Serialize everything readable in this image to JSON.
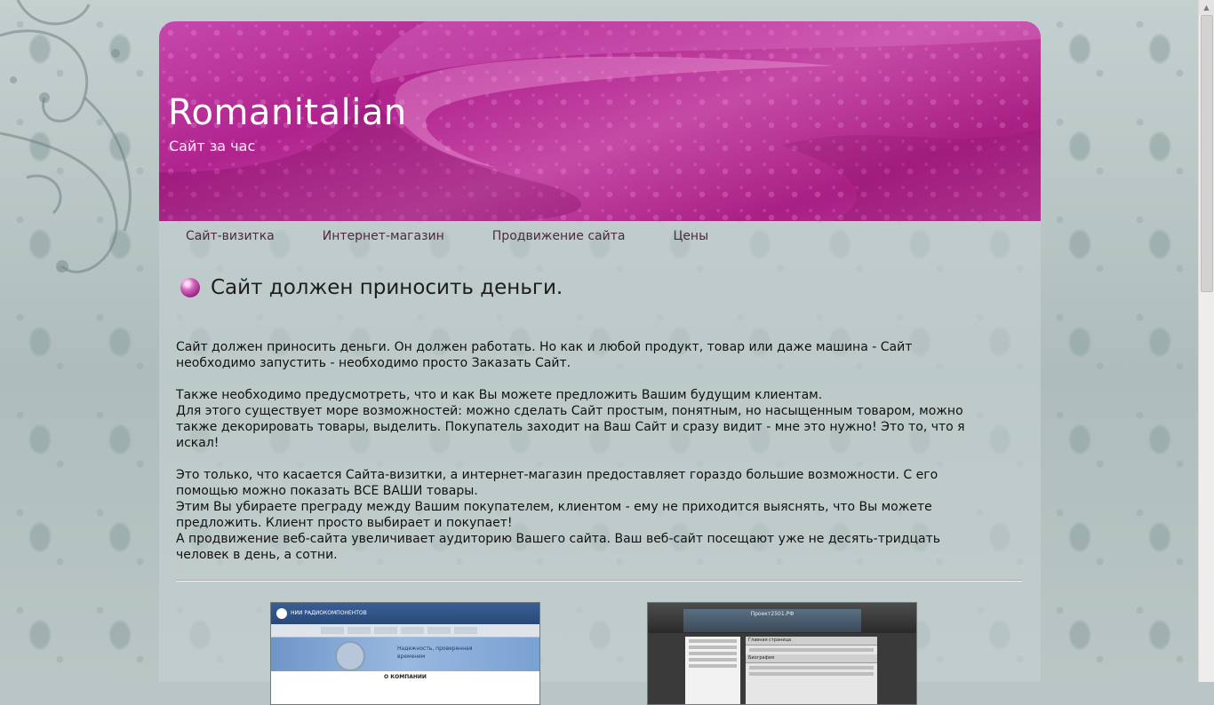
{
  "site": {
    "title": "Romanitalian",
    "tagline": "Сайт за час"
  },
  "nav": {
    "items": [
      {
        "label": "Сайт-визитка"
      },
      {
        "label": "Интернет-магазин"
      },
      {
        "label": "Продвижение сайта"
      },
      {
        "label": "Цены"
      }
    ]
  },
  "article": {
    "heading": "Сайт должен приносить деньги.",
    "p1_l1": "Сайт должен приносить деньги. Он должен работать. Но как и любой продукт, товар или даже машина - Сайт",
    "p1_l2": "необходимо запустить - необходимо просто Заказать Сайт.",
    "p2_l1": "Также необходимо предусмотреть, что и как Вы можете предложить Вашим будущим клиентам.",
    "p2_l2": "Для этого существует море возможностей: можно сделать Сайт простым, понятным, но насыщенным товаром, можно",
    "p2_l3": "также декорировать товары, выделить. Покупатель заходит на Ваш Сайт и сразу видит - мне это нужно! Это то, что я",
    "p2_l4": "искал!",
    "p3_l1": "Это только, что касается Сайта-визитки, а интернет-магазин предоставляет гораздо большие возможности. С его",
    "p3_l2": "помощью можно показать ВСЕ ВАШИ товары.",
    "p3_l3": "Этим Вы убираете преграду между Вашим покупателем, клиентом - ему не приходится выяснять, что Вы можете",
    "p3_l4": "предложить. Клиент просто выбирает и покупает!",
    "p3_l5": "А продвижение веб-сайта увеличивает аудиторию Вашего сайта. Ваш веб-сайт посещают уже не десять-тридцать",
    "p3_l6": "человек в день, а сотни."
  },
  "portfolio": {
    "thumb1": {
      "header": "НИИ РАДИОКОМПОНЕНТОВ",
      "slogan_1": "Надежность, проверенная",
      "slogan_2": "временем",
      "section": "О КОМПАНИИ"
    },
    "thumb2": {
      "header": "Проект2501.РФ",
      "bar1": "Главная страница",
      "bar2": "Биография"
    }
  },
  "colors": {
    "header_accent": "#b0238e",
    "nav_text": "#4d2a3f",
    "title_text": "#ffffff"
  }
}
